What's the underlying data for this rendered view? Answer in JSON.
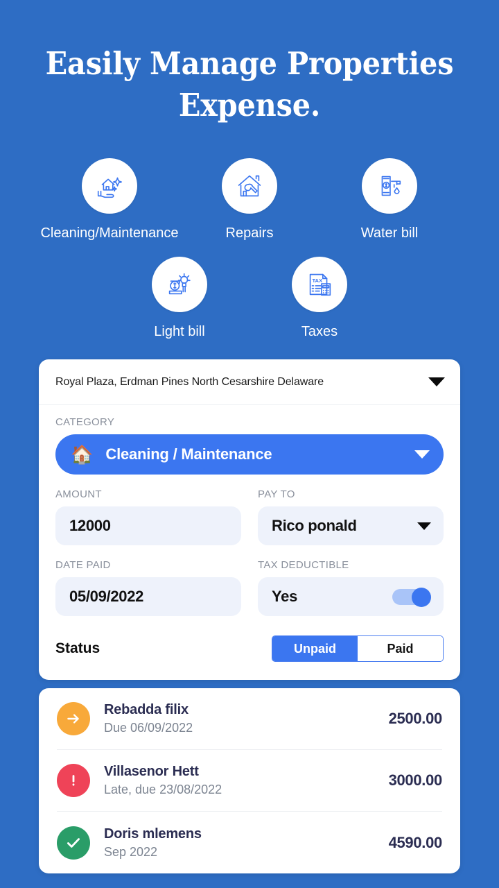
{
  "headline": {
    "line1": "Easily Manage Properties",
    "line2": "Expense."
  },
  "colors": {
    "background": "#2E6DC4",
    "accent_blue": "#3B76F0",
    "input_bg": "#EEF2FB",
    "orange": "#F8A93A",
    "red": "#EF4358",
    "green": "#2A9D68",
    "navy_text": "#2B2D52"
  },
  "categories": [
    {
      "label": "Cleaning/Maintenance",
      "icon": "cleaning-hand-house-icon"
    },
    {
      "label": "Repairs",
      "icon": "house-wrench-icon"
    },
    {
      "label": "Water bill",
      "icon": "water-meter-tap-icon"
    },
    {
      "label": "Light bill",
      "icon": "light-bulb-money-icon"
    },
    {
      "label": "Taxes",
      "icon": "tax-document-calculator-icon"
    }
  ],
  "form": {
    "address": "Royal Plaza, Erdman Pines North Cesarshire Delaware",
    "address_dropdown_icon": "chevron-down-icon",
    "category_label": "CATEGORY",
    "category_value": "Cleaning / Maintenance",
    "category_emoji": "🏠",
    "category_dropdown_icon": "chevron-down-icon",
    "amount_label": "AMOUNT",
    "amount_value": "12000",
    "pay_to_label": "PAY TO",
    "pay_to_value": "Rico ponald",
    "pay_to_dropdown_icon": "chevron-down-icon",
    "date_paid_label": "DATE PAID",
    "date_paid_value": "05/09/2022",
    "tax_deductible_label": "TAX DEDUCTIBLE",
    "tax_deductible_value": "Yes",
    "tax_deductible_toggle": "on",
    "status_label": "Status",
    "status_options": [
      "Unpaid",
      "Paid"
    ],
    "status_selected": "Unpaid"
  },
  "transactions": [
    {
      "name": "Rebadda filix",
      "sub": "Due 06/09/2022",
      "amount": "2500.00",
      "status_icon": "arrow-right-icon",
      "status_color": "#F8A93A"
    },
    {
      "name": "Villasenor Hett",
      "sub": "Late, due 23/08/2022",
      "amount": "3000.00",
      "status_icon": "exclamation-icon",
      "status_color": "#EF4358"
    },
    {
      "name": "Doris mlemens",
      "sub": "Sep 2022",
      "amount": "4590.00",
      "status_icon": "check-icon",
      "status_color": "#2A9D68"
    }
  ]
}
